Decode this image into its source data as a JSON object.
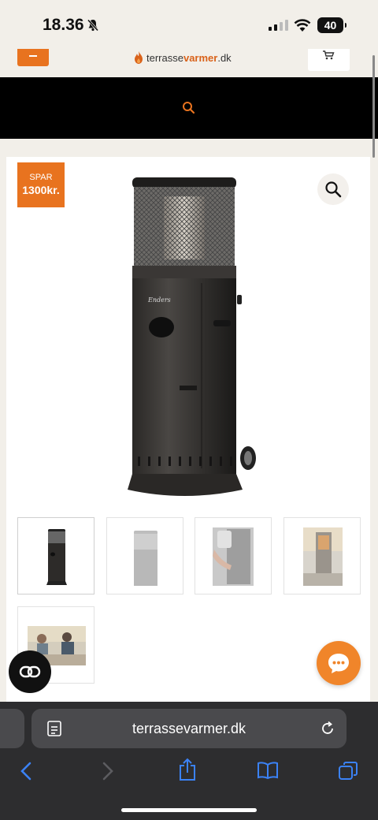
{
  "status_bar": {
    "time": "18.36",
    "battery": "40"
  },
  "header": {
    "logo_prefix": "terrasse",
    "logo_highlight": "varmer",
    "logo_suffix": ".dk"
  },
  "product": {
    "badge_top": "SPAR",
    "badge_bottom": "1300kr.",
    "image": "patio-heater",
    "brand_on_product": "Enders"
  },
  "thumbnails": [
    {
      "name": "thumb-heater-front",
      "active": true
    },
    {
      "name": "thumb-heater-faded",
      "active": false
    },
    {
      "name": "thumb-heater-hand",
      "active": false
    },
    {
      "name": "thumb-heater-outdoor",
      "active": false
    },
    {
      "name": "thumb-heater-people",
      "active": false
    }
  ],
  "browser": {
    "url": "terrassevarmer.dk"
  },
  "colors": {
    "accent": "#e8731f",
    "header_bg": "#000000",
    "page_bg": "#f2efe9",
    "browser_bg": "#2d2d2f"
  }
}
